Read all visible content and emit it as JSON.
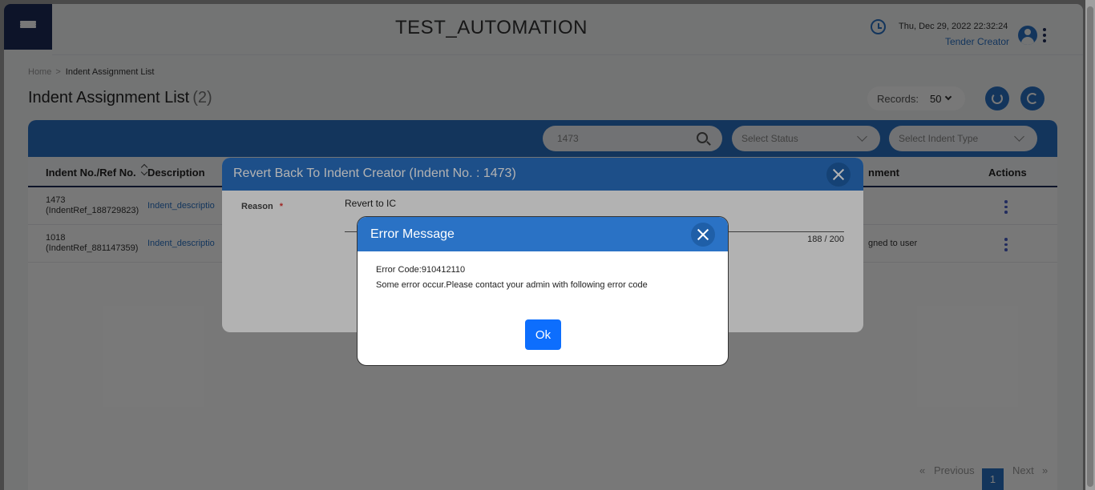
{
  "header": {
    "app_title": "TEST_AUTOMATION",
    "datetime": "Thu, Dec 29, 2022 22:32:24",
    "role": "Tender Creator"
  },
  "breadcrumb": {
    "home": "Home",
    "separator": ">",
    "current": "Indent Assignment List"
  },
  "page": {
    "title": "Indent Assignment List",
    "count": "(2)"
  },
  "records": {
    "label": "Records:",
    "value": "50"
  },
  "filters": {
    "search_value": "1473",
    "status_placeholder": "Select Status",
    "type_placeholder": "Select Indent Type"
  },
  "table": {
    "columns": [
      "Indent No./Ref No.",
      "Description",
      "nment",
      "Actions"
    ],
    "rows": [
      {
        "no": "1473",
        "ref": "(IndentRef_188729823)",
        "desc": "Indent_descriptio",
        "assignment": ""
      },
      {
        "no": "1018",
        "ref": "(IndentRef_881147359)",
        "desc": "Indent_descriptio",
        "assignment": "gned to user"
      }
    ]
  },
  "pagination": {
    "prev_arrow": "«",
    "previous": "Previous",
    "page": "1",
    "next": "Next",
    "next_arrow": "»"
  },
  "revert_modal": {
    "title": "Revert Back To Indent Creator (Indent No. : 1473)",
    "reason_label": "Reason",
    "required_mark": "*",
    "reason_value": "Revert to IC",
    "char_count": "188 / 200"
  },
  "error_modal": {
    "title": "Error Message",
    "code": "Error Code:910412110",
    "message": "Some error occur.Please contact your admin with following error code",
    "ok_label": "Ok"
  },
  "colors": {
    "primary": "#2a72c5",
    "navy": "#1d2b57",
    "ok_button": "#0d6efd",
    "required": "#e53935"
  },
  "icons": [
    "hamburger-menu-icon",
    "clock-icon",
    "user-avatar-icon",
    "more-vertical-icon",
    "refresh-icon",
    "reload-icon",
    "search-icon",
    "chevron-down-icon",
    "sort-icon",
    "close-icon"
  ]
}
